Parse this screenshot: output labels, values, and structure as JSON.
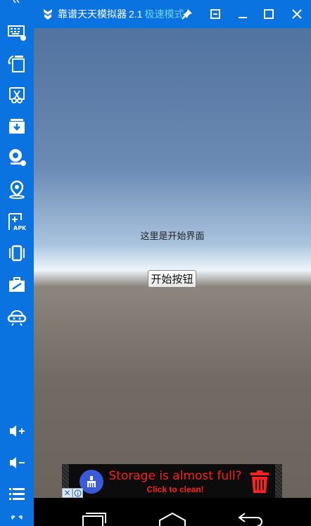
{
  "window": {
    "title": "靠谱天天模拟器",
    "version": "2.1",
    "mode": "极速模式"
  },
  "sidebar": {
    "items": [
      {
        "icon": "keyboard-icon"
      },
      {
        "icon": "rotate-screen-icon"
      },
      {
        "icon": "screenshot-icon"
      },
      {
        "icon": "install-icon"
      },
      {
        "icon": "camera-icon"
      },
      {
        "icon": "location-icon"
      },
      {
        "icon": "apk-install-icon",
        "label": "APK"
      },
      {
        "icon": "shake-icon"
      },
      {
        "icon": "toolbox-icon"
      },
      {
        "icon": "robot-icon"
      },
      {
        "icon": "volume-up-icon"
      },
      {
        "icon": "volume-down-icon"
      },
      {
        "icon": "menu-icon"
      },
      {
        "icon": "fullscreen-icon"
      }
    ]
  },
  "screen": {
    "label": "这里是开始界面",
    "button_label": "开始按钮"
  },
  "ad": {
    "headline": "Storage is almost full?",
    "subline": "Click to clean!",
    "close_glyph": "✕"
  },
  "colors": {
    "accent": "#0a73e0",
    "mode_text": "#6fd2ff",
    "ad_text": "#ff2020"
  }
}
